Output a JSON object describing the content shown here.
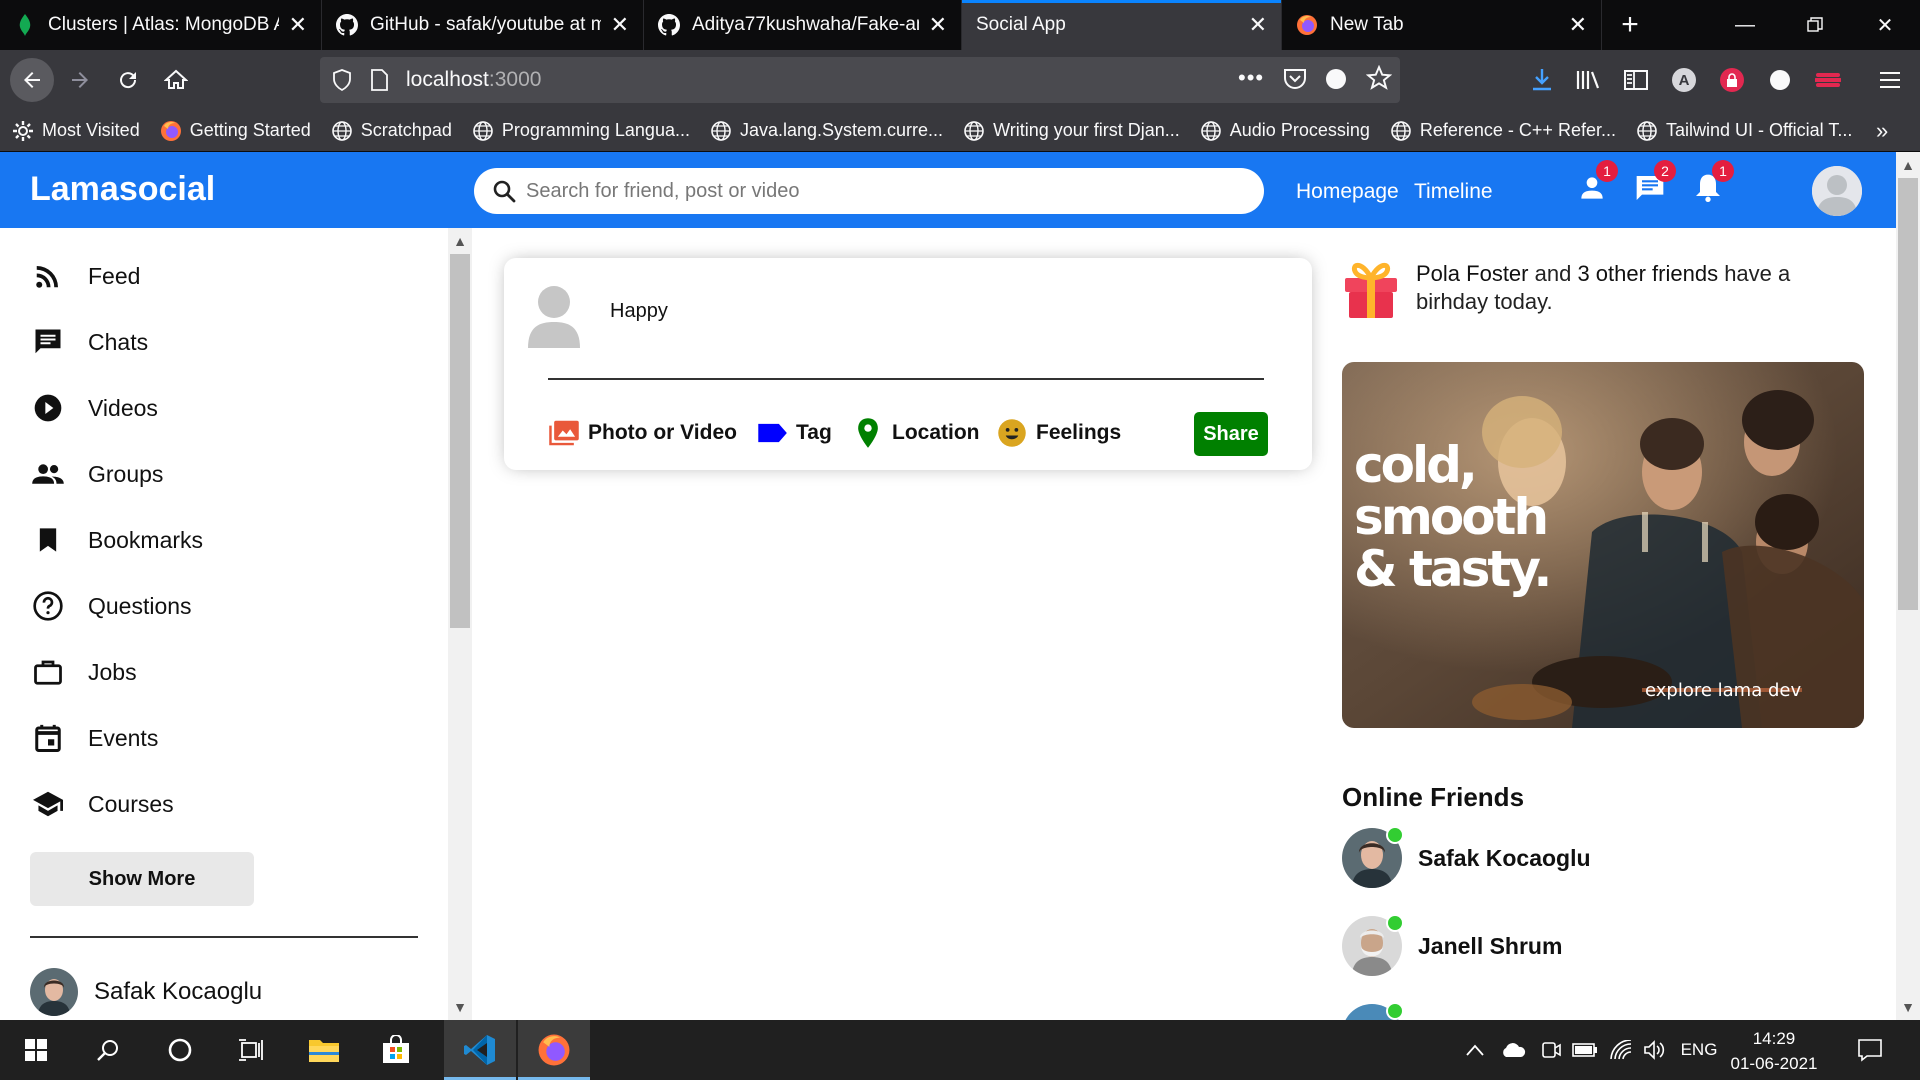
{
  "browser": {
    "tabs": [
      {
        "title": "Clusters | Atlas: MongoDB Atl",
        "icon": "mongodb-leaf-icon",
        "active": false
      },
      {
        "title": "GitHub - safak/youtube at ma",
        "icon": "github-icon",
        "active": false
      },
      {
        "title": "Aditya77kushwaha/Fake-ama",
        "icon": "github-icon",
        "active": false
      },
      {
        "title": "Social App",
        "icon": "",
        "active": true
      },
      {
        "title": "New Tab",
        "icon": "firefox-icon",
        "active": false
      }
    ],
    "url_host": "localhost",
    "url_port": ":3000",
    "bookmarks": [
      {
        "label": "Most Visited",
        "icon": "gear-icon"
      },
      {
        "label": "Getting Started",
        "icon": "firefox-icon"
      },
      {
        "label": "Scratchpad",
        "icon": "globe-icon"
      },
      {
        "label": "Programming Langua...",
        "icon": "globe-icon"
      },
      {
        "label": "Java.lang.System.curre...",
        "icon": "globe-icon"
      },
      {
        "label": "Writing your first Djan...",
        "icon": "globe-icon"
      },
      {
        "label": "Audio Processing",
        "icon": "globe-icon"
      },
      {
        "label": "Reference - C++ Refer...",
        "icon": "globe-icon"
      },
      {
        "label": "Tailwind UI - Official T...",
        "icon": "globe-icon"
      }
    ]
  },
  "app": {
    "logo": "Lamasocial",
    "search_placeholder": "Search for friend, post or video",
    "nav_links": [
      "Homepage",
      "Timeline"
    ],
    "badges": {
      "friends": "1",
      "messages": "2",
      "notifications": "1"
    },
    "brand_color": "#1877f2"
  },
  "sidebar": {
    "items": [
      {
        "label": "Feed",
        "icon": "rss-feed-icon"
      },
      {
        "label": "Chats",
        "icon": "chat-icon"
      },
      {
        "label": "Videos",
        "icon": "play-circle-icon"
      },
      {
        "label": "Groups",
        "icon": "group-icon"
      },
      {
        "label": "Bookmarks",
        "icon": "bookmark-icon"
      },
      {
        "label": "Questions",
        "icon": "help-outline-icon"
      },
      {
        "label": "Jobs",
        "icon": "work-outline-icon"
      },
      {
        "label": "Events",
        "icon": "event-icon"
      },
      {
        "label": "Courses",
        "icon": "school-icon"
      }
    ],
    "show_more": "Show More",
    "friends": [
      {
        "name": "Safak Kocaoglu"
      }
    ]
  },
  "share": {
    "input_text": "Happy",
    "options": [
      {
        "label": "Photo or Video",
        "icon": "perm-media-icon",
        "color": "#e9583a"
      },
      {
        "label": "Tag",
        "icon": "label-icon",
        "color": "#0000ff"
      },
      {
        "label": "Location",
        "icon": "room-icon",
        "color": "#008000"
      },
      {
        "label": "Feelings",
        "icon": "emoji-emotions-icon",
        "color": "#daa520"
      }
    ],
    "button": "Share"
  },
  "rightbar": {
    "birthday_name": "Pola Foster",
    "birthday_mid": " and ",
    "birthday_count": "3 other friends",
    "birthday_end": " have a birhday today.",
    "ad_text_line1": "cold,",
    "ad_text_line2": "smooth",
    "ad_text_line3": "& tasty.",
    "ad_footer": "explore lama dev",
    "online_title": "Online Friends",
    "online_friends": [
      {
        "name": "Safak Kocaoglu"
      },
      {
        "name": "Janell Shrum"
      }
    ]
  },
  "taskbar": {
    "language": "ENG",
    "time": "14:29",
    "date": "01-06-2021"
  }
}
